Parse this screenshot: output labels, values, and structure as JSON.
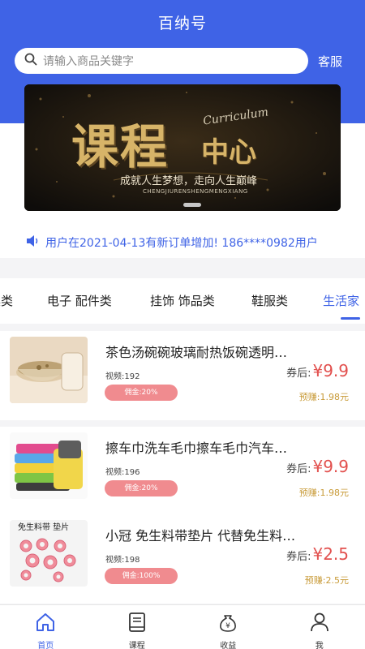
{
  "header": {
    "title": "百纳号",
    "search_placeholder": "请输入商品关键字",
    "service_label": "客服",
    "background_color": "#3f63e6"
  },
  "banner": {
    "title_main": "课程",
    "title_sub": "中心",
    "script_text": "Curriculum",
    "slogan": "成就人生梦想，走向人生巅峰",
    "pinyin": "CHENGJIURENSHENGMENGXIANG"
  },
  "notice": {
    "icon": "speaker-icon",
    "text": "用户在2021-04-13有新订单增加! 186****0982用户"
  },
  "categories": [
    {
      "label": "具类",
      "active": false
    },
    {
      "label": "电子 配件类",
      "active": false
    },
    {
      "label": "挂饰 饰品类",
      "active": false
    },
    {
      "label": "鞋服类",
      "active": false
    },
    {
      "label": "生活家",
      "active": true
    }
  ],
  "products": [
    {
      "title": "茶色汤碗碗玻璃耐热饭碗透明…",
      "views": "视频:192",
      "commission": "佣金:20%",
      "price_label": "券后:",
      "price": "¥9.9",
      "earn": "预赚:1.98元"
    },
    {
      "title": "擦车巾洗车毛巾擦车毛巾汽车…",
      "views": "视频:196",
      "commission": "佣金:20%",
      "price_label": "券后:",
      "price": "¥9.9",
      "earn": "预赚:1.98元"
    },
    {
      "title": "小冠 免生料带垫片 代替免生料…",
      "views": "视频:198",
      "commission": "佣金:100%",
      "price_label": "券后:",
      "price": "¥2.5",
      "earn": "预赚:2.5元",
      "thumb_caption": "免生料带 垫片"
    }
  ],
  "tabbar": [
    {
      "label": "首页",
      "icon": "home-icon",
      "active": true
    },
    {
      "label": "课程",
      "icon": "book-icon",
      "active": false
    },
    {
      "label": "收益",
      "icon": "money-bag-icon",
      "active": false
    },
    {
      "label": "我",
      "icon": "user-icon",
      "active": false
    }
  ],
  "colors": {
    "accent": "#3f63e6",
    "price": "#e2504e",
    "commission_badge": "#f08b8f",
    "earn": "#c89a37"
  }
}
